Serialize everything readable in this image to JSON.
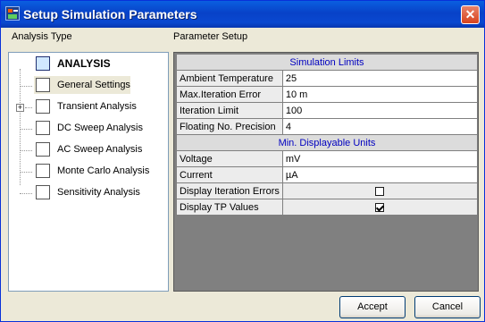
{
  "window": {
    "title": "Setup Simulation Parameters"
  },
  "labels": {
    "analysis_type": "Analysis Type",
    "parameter_setup": "Parameter Setup"
  },
  "tree": {
    "root": "ANALYSIS",
    "items": [
      {
        "label": "General Settings",
        "icon": "general-settings-icon"
      },
      {
        "label": "Transient Analysis",
        "icon": "transient-analysis-icon",
        "expander": "+"
      },
      {
        "label": "DC Sweep Analysis",
        "icon": "dc-sweep-icon"
      },
      {
        "label": "AC Sweep Analysis",
        "icon": "ac-sweep-icon"
      },
      {
        "label": "Monte Carlo Analysis",
        "icon": "monte-carlo-icon"
      },
      {
        "label": "Sensitivity Analysis",
        "icon": "sensitivity-icon"
      }
    ]
  },
  "grid": {
    "section1": "Simulation Limits",
    "rows1": [
      {
        "name": "Ambient Temperature",
        "value": "25"
      },
      {
        "name": "Max.Iteration Error",
        "value": "10 m"
      },
      {
        "name": "Iteration Limit",
        "value": "100"
      },
      {
        "name": "Floating No. Precision",
        "value": "4"
      }
    ],
    "section2": "Min. Displayable Units",
    "rows2": [
      {
        "name": "Voltage",
        "value": "mV"
      },
      {
        "name": "Current",
        "value": "µA"
      },
      {
        "name": "Display Iteration Errors",
        "checked": false
      },
      {
        "name": "Display TP Values",
        "checked": true
      }
    ]
  },
  "buttons": {
    "accept": "Accept",
    "cancel": "Cancel"
  },
  "close_glyph": "✕"
}
